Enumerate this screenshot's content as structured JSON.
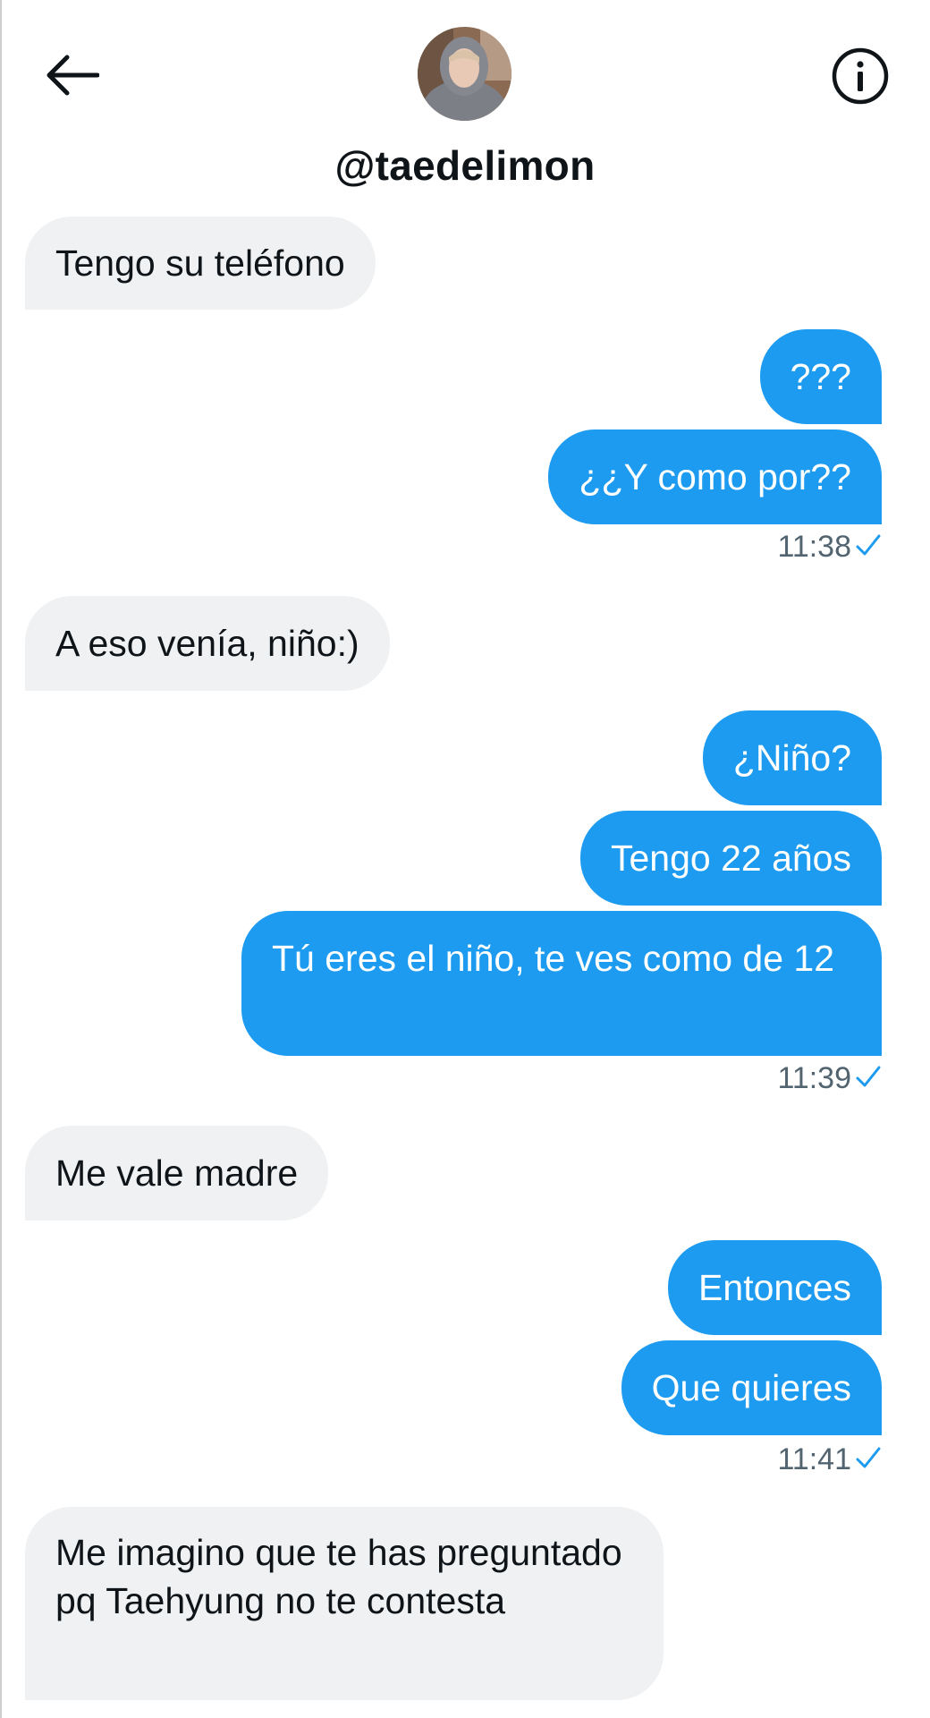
{
  "header": {
    "username": "@taedelimon",
    "back_icon": "arrow-left-icon",
    "info_icon": "info-circle-icon"
  },
  "colors": {
    "sent_bubble": "#1d9bf0",
    "received_bubble": "#eff1f3",
    "timestamp": "#536471",
    "check": "#1d9bf0"
  },
  "messages": [
    {
      "direction": "received",
      "text": "Tengo su teléfono"
    },
    {
      "direction": "sent",
      "text": "???"
    },
    {
      "direction": "sent",
      "text": "¿¿Y como por??"
    },
    {
      "direction": "received",
      "text": "A eso venía, niño:)"
    },
    {
      "direction": "sent",
      "text": "¿Niño?"
    },
    {
      "direction": "sent",
      "text": "Tengo 22 años"
    },
    {
      "direction": "sent",
      "text": "Tú eres el niño, te ves como de 12"
    },
    {
      "direction": "received",
      "text": "Me vale madre"
    },
    {
      "direction": "sent",
      "text": "Entonces"
    },
    {
      "direction": "sent",
      "text": "Que quieres"
    },
    {
      "direction": "received",
      "text": "Me imagino que te has preguntado pq Taehyung no te contesta"
    }
  ],
  "timestamps": [
    "11:38",
    "11:39",
    "11:41"
  ],
  "status_icon": "check-icon"
}
